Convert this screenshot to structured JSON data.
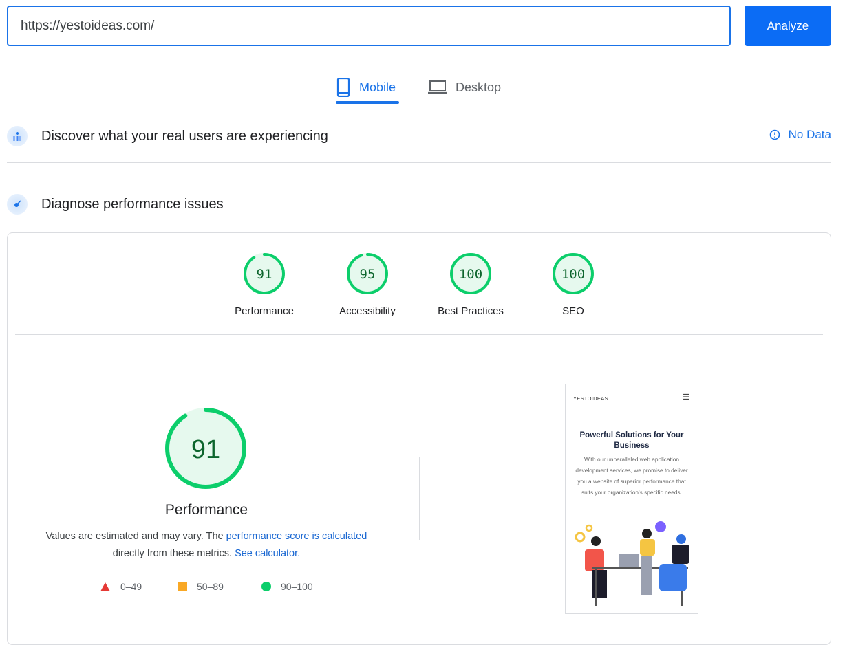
{
  "search": {
    "url": "https://yestoideas.com/",
    "analyze_label": "Analyze"
  },
  "tabs": [
    {
      "label": "Mobile",
      "icon": "mobile-icon",
      "active": true
    },
    {
      "label": "Desktop",
      "icon": "laptop-icon",
      "active": false
    }
  ],
  "field_data": {
    "title": "Discover what your real users are experiencing",
    "status": "No Data",
    "status_icon": "info-icon"
  },
  "lab": {
    "title": "Diagnose performance issues"
  },
  "scores": [
    {
      "label": "Performance",
      "value": 91
    },
    {
      "label": "Accessibility",
      "value": 95
    },
    {
      "label": "Best Practices",
      "value": 100
    },
    {
      "label": "SEO",
      "value": 100
    }
  ],
  "performance": {
    "value": 91,
    "title": "Performance",
    "desc_prefix": "Values are estimated and may vary. The ",
    "desc_link1": "performance score is calculated",
    "desc_mid": "directly from these metrics. ",
    "desc_link2": "See calculator.",
    "legend": [
      {
        "range": "0–49",
        "color": "#e53935",
        "shape": "triangle"
      },
      {
        "range": "50–89",
        "color": "#f9a825",
        "shape": "square"
      },
      {
        "range": "90–100",
        "color": "#0cce6b",
        "shape": "circle"
      }
    ]
  },
  "screenshot": {
    "brand": "YESTOIDEAS",
    "heading": "Powerful Solutions for Your Business",
    "body": "With our unparalleled web application development services, we promise to deliver you a website of superior performance that suits your organization's specific needs."
  },
  "colors": {
    "accent": "#1a73e8",
    "pass": "#0cce6b",
    "pass_text": "#0d652d"
  }
}
